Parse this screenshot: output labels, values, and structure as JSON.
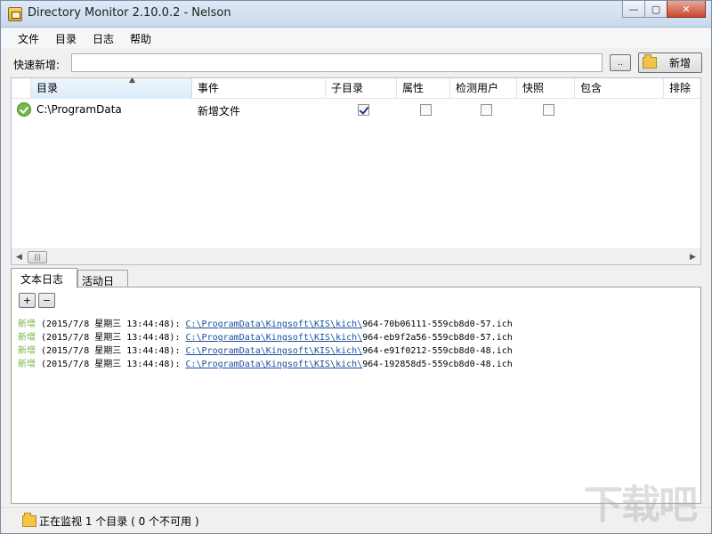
{
  "window": {
    "title": "Directory Monitor 2.10.0.2 - Nelson",
    "controls": {
      "minimize": "—",
      "maximize": "▢",
      "close": "✕"
    }
  },
  "menu": [
    "文件",
    "目录",
    "日志",
    "帮助"
  ],
  "quick_add": {
    "label": "快速新增:",
    "value": "",
    "browse_label": "..",
    "add_label": "新增"
  },
  "directory_table": {
    "columns": [
      "目录",
      "事件",
      "子目录",
      "属性",
      "检测用户",
      "快照",
      "包含",
      "排除"
    ],
    "sorted_column": "目录",
    "rows": [
      {
        "status_icon": "ok-check-icon",
        "path": "C:\\ProgramData",
        "event": "新增文件",
        "subdirectory": true,
        "attributes": false,
        "detect_user": false,
        "snapshot": false,
        "include": "",
        "exclude": ""
      }
    ]
  },
  "scrollbar": {
    "left_arrow": "◀",
    "right_arrow": "▶",
    "thumb_grip": "|||"
  },
  "tabs": [
    {
      "label": "文本日志",
      "active": true
    },
    {
      "label": "活动日志",
      "active": false
    }
  ],
  "log_toolbar": {
    "expand": "+",
    "collapse": "−"
  },
  "log_entries": [
    {
      "tag": "新增",
      "time": "(2015/7/8 星期三 13:44:48):",
      "path": "C:\\ProgramData\\Kingsoft\\KIS\\kich\\",
      "file": "964-70b06111-559cb8d0-57.ich"
    },
    {
      "tag": "新增",
      "time": "(2015/7/8 星期三 13:44:48):",
      "path": "C:\\ProgramData\\Kingsoft\\KIS\\kich\\",
      "file": "964-eb9f2a56-559cb8d0-57.ich"
    },
    {
      "tag": "新增",
      "time": "(2015/7/8 星期三 13:44:48):",
      "path": "C:\\ProgramData\\Kingsoft\\KIS\\kich\\",
      "file": "964-e91f0212-559cb8d0-48.ich"
    },
    {
      "tag": "新增",
      "time": "(2015/7/8 星期三 13:44:48):",
      "path": "C:\\ProgramData\\Kingsoft\\KIS\\kich\\",
      "file": "964-192858d5-559cb8d0-48.ich"
    }
  ],
  "status": {
    "text": "正在监视 1 个目录 ( 0 个不可用 )"
  },
  "watermark": "下载吧",
  "colors": {
    "log_tag": "#7cb342",
    "log_path": "#1a4f9c",
    "ok_icon": "#7ab648"
  }
}
